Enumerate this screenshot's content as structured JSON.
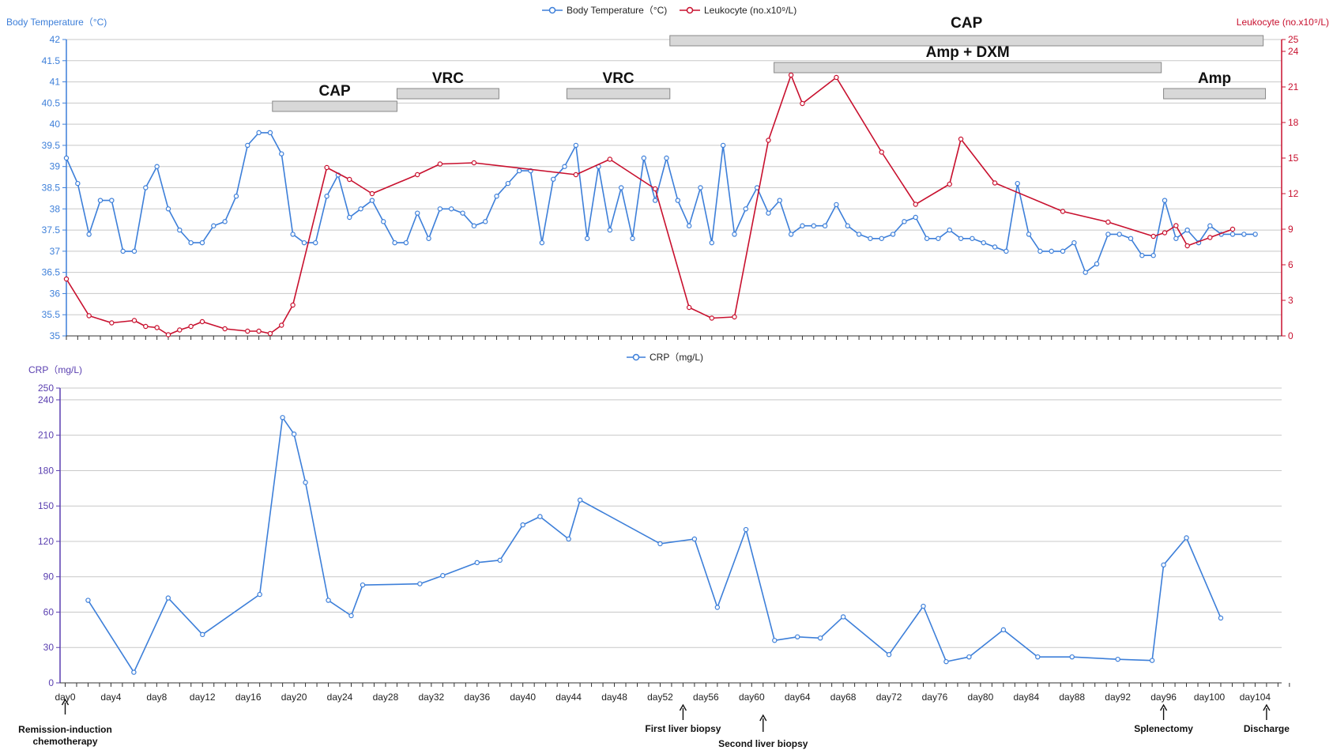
{
  "legend_top": {
    "temperature": "Body Temperature（°C)",
    "leukocyte": "Leukocyte (no.x10⁹/L)"
  },
  "legend_bottom": {
    "crp": "CRP（mg/L)"
  },
  "axes": {
    "temp_title": "Body Temperature（°C)",
    "leuk_title": "Leukocyte (no.x10⁹/L)",
    "crp_title": "CRP（mg/L)"
  },
  "colors": {
    "temperature": "#3d7fd9",
    "leukocyte": "#c8102e",
    "crp": "#3d7fd9",
    "crp_axis": "#5a3fb0",
    "bar_fill": "#d8d8d8",
    "bar_stroke": "#888888",
    "grid": "#c8c8c8"
  },
  "chart_data": [
    {
      "type": "line",
      "title": "",
      "ylabel": "Body Temperature（°C)",
      "y2label": "Leukocyte (no.x10⁹/L)",
      "ylim": [
        35,
        42
      ],
      "y2lim": [
        0,
        25
      ],
      "xlim": [
        0,
        108
      ],
      "yticks": [
        35,
        35.5,
        36,
        36.5,
        37,
        37.5,
        38,
        38.5,
        39,
        39.5,
        40,
        40.5,
        41,
        41.5,
        42
      ],
      "y2ticks": [
        0,
        3,
        6,
        9,
        12,
        15,
        18,
        21,
        24,
        25
      ],
      "grid": true,
      "legend_position": "top-center",
      "series": [
        {
          "name": "Body Temperature（°C)",
          "axis": "left",
          "x": [
            0,
            1,
            2,
            3,
            4,
            5,
            6,
            7,
            8,
            9,
            10,
            11,
            12,
            13,
            14,
            15,
            16,
            17,
            18,
            19,
            20,
            21,
            22,
            23,
            24,
            25,
            26,
            27,
            28,
            29,
            30,
            31,
            32,
            33,
            34,
            35,
            36,
            37,
            38,
            39,
            40,
            41,
            42,
            43,
            44,
            45,
            46,
            47,
            48,
            49,
            50,
            51,
            52,
            53,
            54,
            55,
            56,
            57,
            58,
            59,
            60,
            61,
            62,
            63,
            64,
            65,
            66,
            67,
            68,
            69,
            70,
            71,
            72,
            73,
            74,
            75,
            76,
            77,
            78,
            79,
            80,
            81,
            82,
            83,
            84,
            85,
            86,
            87,
            88,
            89,
            90,
            91,
            92,
            93,
            94,
            95,
            96,
            97,
            98,
            99,
            100,
            101,
            102,
            103,
            104,
            105
          ],
          "y": [
            39.2,
            38.6,
            37.4,
            38.2,
            38.2,
            37.0,
            37.0,
            38.5,
            39.0,
            38.0,
            37.5,
            37.2,
            37.2,
            37.6,
            37.7,
            38.3,
            39.5,
            39.8,
            39.8,
            39.3,
            37.4,
            37.2,
            37.2,
            38.3,
            38.8,
            37.8,
            38.0,
            38.2,
            37.7,
            37.2,
            37.2,
            37.9,
            37.3,
            38.0,
            38.0,
            37.9,
            37.6,
            37.7,
            38.3,
            38.6,
            38.9,
            38.9,
            37.2,
            38.7,
            39.0,
            39.5,
            37.3,
            39.0,
            37.5,
            38.5,
            37.3,
            39.2,
            38.2,
            39.2,
            38.2,
            37.6,
            38.5,
            37.2,
            39.5,
            37.4,
            38.0,
            38.5,
            37.9,
            38.2,
            37.4,
            37.6,
            37.6,
            37.6,
            38.1,
            37.6,
            37.4,
            37.3,
            37.3,
            37.4,
            37.7,
            37.8,
            37.3,
            37.3,
            37.5,
            37.3,
            37.3,
            37.2,
            37.1,
            37.0,
            38.6,
            37.4,
            37.0,
            37.0,
            37.0,
            37.2,
            36.5,
            36.7,
            37.4,
            37.4,
            37.3,
            36.9,
            36.9,
            38.2,
            37.3,
            37.5,
            37.2,
            37.6,
            37.4,
            37.4,
            37.4,
            37.4
          ]
        },
        {
          "name": "Leukocyte (no.x10⁹/L)",
          "axis": "right",
          "x": [
            0,
            2,
            4,
            6,
            7,
            8,
            9,
            10,
            11,
            12,
            14,
            16,
            17,
            18,
            19,
            20,
            23,
            25,
            27,
            31,
            33,
            36,
            45,
            48,
            52,
            55,
            57,
            59,
            62,
            64,
            65,
            68,
            72,
            75,
            78,
            79,
            82,
            88,
            92,
            96,
            97,
            98,
            99,
            101,
            103
          ],
          "y": [
            4.8,
            1.7,
            1.1,
            1.3,
            0.8,
            0.7,
            0.1,
            0.5,
            0.8,
            1.2,
            0.6,
            0.4,
            0.4,
            0.2,
            0.9,
            2.6,
            14.2,
            13.2,
            12.0,
            13.6,
            14.5,
            14.6,
            13.6,
            14.9,
            12.4,
            2.4,
            1.5,
            1.6,
            16.5,
            22.0,
            19.6,
            21.8,
            15.5,
            11.1,
            12.8,
            16.6,
            12.9,
            10.5,
            9.6,
            8.4,
            8.7,
            9.3,
            7.6,
            8.3,
            9.0
          ]
        }
      ],
      "treatment_bars": [
        {
          "label": "CAP",
          "start": 18.2,
          "end": 29.2
        },
        {
          "label": "VRC",
          "start": 29.2,
          "end": 38.2
        },
        {
          "label": "VRC",
          "start": 44.2,
          "end": 53.3
        },
        {
          "label": "CAP",
          "start": 53.3,
          "end": 105.7
        },
        {
          "label": "Amp + DXM",
          "start": 62.5,
          "end": 96.7
        },
        {
          "label": "Amp",
          "start": 96.9,
          "end": 105.9
        }
      ]
    },
    {
      "type": "line",
      "title": "",
      "ylabel": "CRP（mg/L)",
      "ylim": [
        0,
        250
      ],
      "yticks": [
        0,
        30,
        60,
        90,
        120,
        150,
        180,
        210,
        240,
        250
      ],
      "grid": true,
      "legend_position": "top-center",
      "x_tick_labels": [
        "day0",
        "day4",
        "day8",
        "day12",
        "day16",
        "day20",
        "day24",
        "day28",
        "day32",
        "day36",
        "day40",
        "day44",
        "day48",
        "day52",
        "day56",
        "day60",
        "day64",
        "day68",
        "day72",
        "day76",
        "day80",
        "day84",
        "day88",
        "day92",
        "day96",
        "day100",
        "day104"
      ],
      "series": [
        {
          "name": "CRP（mg/L)",
          "x": [
            2,
            6,
            9,
            12,
            17,
            19,
            20,
            21,
            23,
            25,
            26,
            31,
            33,
            36,
            38,
            40,
            41.5,
            44,
            45,
            52,
            55,
            57,
            59.5,
            62,
            64,
            66,
            68,
            72,
            75,
            77,
            79,
            82,
            85,
            88,
            92,
            95,
            96,
            98,
            101
          ],
          "y": [
            70,
            9,
            72,
            41,
            75,
            225,
            211,
            170,
            70,
            57,
            83,
            84,
            91,
            102,
            104,
            134,
            141,
            122,
            155,
            118,
            122,
            64,
            130,
            36,
            39,
            38,
            56,
            24,
            65,
            18,
            22,
            45,
            22,
            22,
            20,
            19,
            100,
            123,
            55
          ]
        }
      ],
      "annotations": [
        {
          "day": 0,
          "label": "Remission-induction chemotherapy"
        },
        {
          "day": 54,
          "label": "First liver biopsy"
        },
        {
          "day": 61,
          "label": "Second liver biopsy"
        },
        {
          "day": 96,
          "label": "Splenectomy"
        },
        {
          "day": 105,
          "label": "Discharge"
        }
      ]
    }
  ]
}
